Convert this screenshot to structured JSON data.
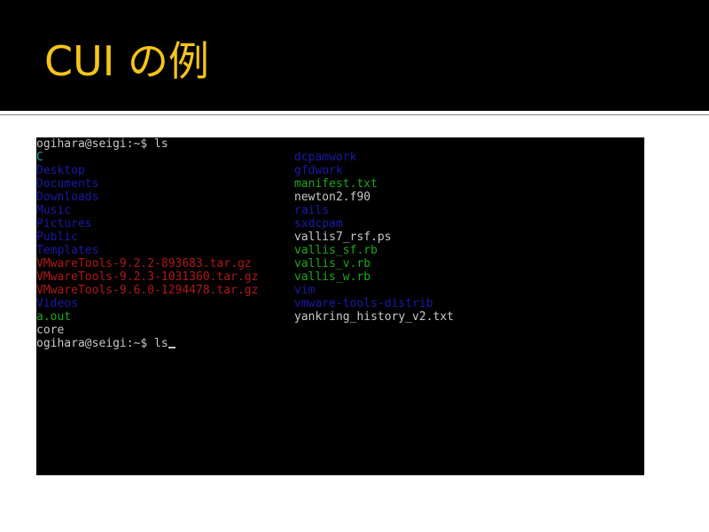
{
  "slide": {
    "title": "CUI の例"
  },
  "colors": {
    "title": "#f5c518",
    "directory": "#1a1aa6",
    "executable": "#1fa81f",
    "archive": "#b21818",
    "plain": "#c8c8c8",
    "special": "#18a3a3"
  },
  "terminal": {
    "prompt_1": "ogihara@seigi:~$ ls",
    "prompt_2": "ogihara@seigi:~$ ls",
    "left_column": [
      {
        "name": "C",
        "kind": "special"
      },
      {
        "name": "Desktop",
        "kind": "directory"
      },
      {
        "name": "Documents",
        "kind": "directory"
      },
      {
        "name": "Downloads",
        "kind": "directory"
      },
      {
        "name": "Music",
        "kind": "directory"
      },
      {
        "name": "Pictures",
        "kind": "directory"
      },
      {
        "name": "Public",
        "kind": "directory"
      },
      {
        "name": "Templates",
        "kind": "directory"
      },
      {
        "name": "VMwareTools-9.2.2-893683.tar.gz",
        "kind": "archive"
      },
      {
        "name": "VMwareTools-9.2.3-1031360.tar.gz",
        "kind": "archive"
      },
      {
        "name": "VMwareTools-9.6.0-1294478.tar.gz",
        "kind": "archive"
      },
      {
        "name": "Videos",
        "kind": "directory"
      },
      {
        "name": "a.out",
        "kind": "executable"
      },
      {
        "name": "core",
        "kind": "plain"
      }
    ],
    "right_column": [
      {
        "name": "dcpamwork",
        "kind": "directory"
      },
      {
        "name": "gfdwork",
        "kind": "directory"
      },
      {
        "name": "manifest.txt",
        "kind": "executable"
      },
      {
        "name": "newton2.f90",
        "kind": "plain"
      },
      {
        "name": "rails",
        "kind": "directory"
      },
      {
        "name": "sxdcpam",
        "kind": "directory"
      },
      {
        "name": "vallis7_rsf.ps",
        "kind": "plain"
      },
      {
        "name": "vallis_sf.rb",
        "kind": "executable"
      },
      {
        "name": "vallis_v.rb",
        "kind": "executable"
      },
      {
        "name": "vallis_w.rb",
        "kind": "executable"
      },
      {
        "name": "vim",
        "kind": "directory"
      },
      {
        "name": "vmware-tools-distrib",
        "kind": "directory"
      },
      {
        "name": "yankring_history_v2.txt",
        "kind": "plain"
      }
    ]
  }
}
